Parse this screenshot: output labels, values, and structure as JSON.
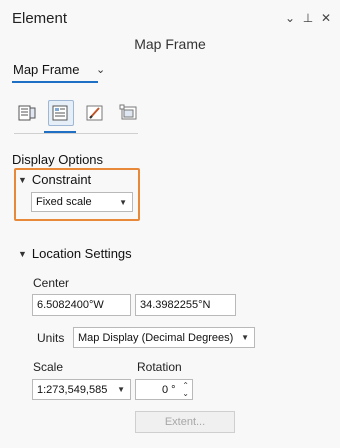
{
  "panel": {
    "title": "Element",
    "subtitle": "Map Frame",
    "controls": {
      "menu_icon": "⌄",
      "pin_icon": "📌",
      "close_icon": "✕"
    }
  },
  "frame_selector": {
    "value": "Map Frame"
  },
  "tabs": [
    {
      "icon": "options-icon",
      "active": false
    },
    {
      "icon": "display-icon",
      "active": true
    },
    {
      "icon": "pen-icon",
      "active": false
    },
    {
      "icon": "placement-icon",
      "active": false
    }
  ],
  "display_options": {
    "title": "Display Options",
    "constraint": {
      "label": "Constraint",
      "dropdown_value": "Fixed scale"
    }
  },
  "location_settings": {
    "label": "Location Settings",
    "center_label": "Center",
    "x_value": "6.5082400°W",
    "y_value": "34.3982255°N",
    "units_label": "Units",
    "units_value": "Map Display (Decimal Degrees)",
    "scale_label": "Scale",
    "scale_value": "1:273,549,585",
    "rotation_label": "Rotation",
    "rotation_value": "0 °",
    "extent_button": "Extent..."
  },
  "colors": {
    "accent_blue": "#1f6fc5",
    "highlight_orange": "#e8893a"
  }
}
